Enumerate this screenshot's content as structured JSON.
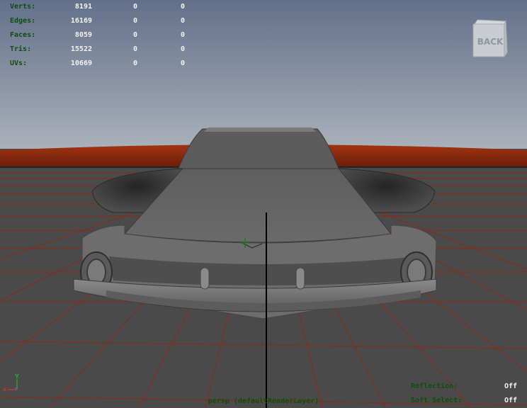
{
  "hud": {
    "stats": [
      {
        "label": "Verts:",
        "v1": "8191",
        "v2": "0",
        "v3": "0"
      },
      {
        "label": "Edges:",
        "v1": "16169",
        "v2": "0",
        "v3": "0"
      },
      {
        "label": "Faces:",
        "v1": "8059",
        "v2": "0",
        "v3": "0"
      },
      {
        "label": "Tris:",
        "v1": "15522",
        "v2": "0",
        "v3": "0"
      },
      {
        "label": "UVs:",
        "v1": "10669",
        "v2": "0",
        "v3": "0"
      }
    ],
    "reflection_label": "Reflection:",
    "reflection_value": "Off",
    "soft_select_label": "Soft Select:",
    "soft_select_value": "Off"
  },
  "camera_label": "persp (defaultRenderLayer)",
  "viewcube": {
    "label": "BACK"
  },
  "axis": {
    "y": "Y",
    "x": "x"
  },
  "colors": {
    "hud_label": "#0d4f0d",
    "hud_value": "#f2f2f2",
    "grid": "#8c2a14",
    "sky_top": "#62708a",
    "sky_bottom": "#acb2bb",
    "floor": "#4a4a4a"
  }
}
